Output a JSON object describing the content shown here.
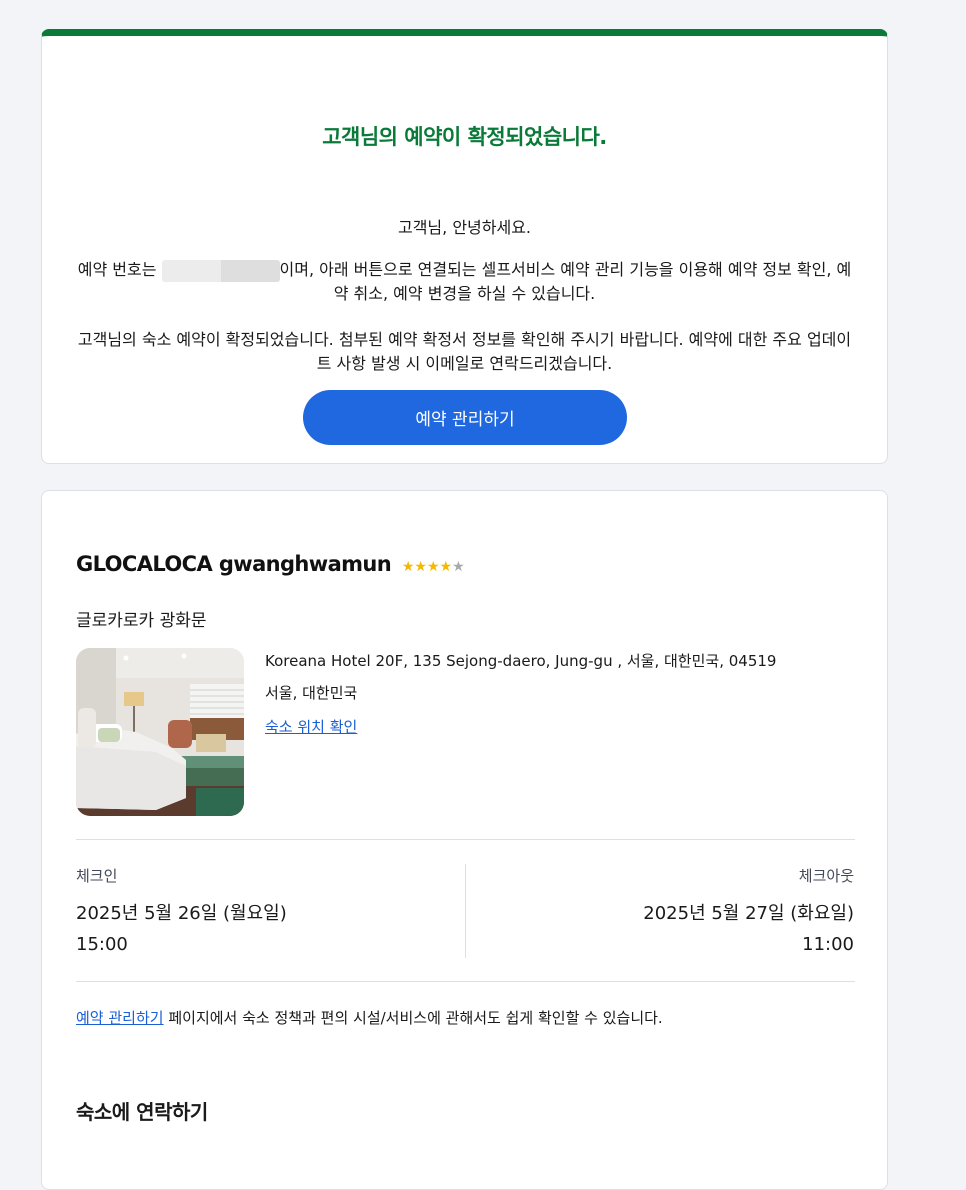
{
  "confirmation": {
    "title": "고객님의 예약이 확정되었습니다.",
    "greeting": "고객님, 안녕하세요.",
    "booking_prefix": "예약 번호는",
    "booking_suffix": "이며, 아래 버튼으로 연결되는 셀프서비스 예약 관리 기능을 이용해 예약 정보 확인, 예약 취소, 예약 변경을 하실 수 있습니다.",
    "notice": "고객님의 숙소 예약이 확정되었습니다. 첨부된 예약 확정서 정보를 확인해 주시기 바랍니다. 예약에 대한 주요 업데이트 사항 발생 시 이메일로 연락드리겠습니다.",
    "manage_button": "예약 관리하기"
  },
  "hotel": {
    "name": "GLOCALOCA gwanghwamun",
    "stars_on": "★★★★",
    "stars_off": "★",
    "rating": 4,
    "local_name": "글로카로카 광화문",
    "address_line1": "Koreana Hotel 20F, 135 Sejong-daero, Jung-gu , 서울, 대한민국, 04519",
    "address_line2": "서울, 대한민국",
    "map_link": "숙소 위치 확인",
    "checkin_label": "체크인",
    "checkin_date": "2025년 5월 26일 (월요일)",
    "checkin_time": "15:00",
    "checkout_label": "체크아웃",
    "checkout_date": "2025년 5월 27일 (화요일)",
    "checkout_time": "11:00",
    "policy_link": "예약 관리하기",
    "policy_text": " 페이지에서 숙소 정책과 편의 시설/서비스에 관해서도 쉽게 확인할 수 있습니다.",
    "contact_title": "숙소에 연락하기"
  },
  "colors": {
    "accent_green": "#0a7a38",
    "button_blue": "#1f68e0",
    "link_blue": "#1a5fd6",
    "star_gold": "#f5b800"
  }
}
